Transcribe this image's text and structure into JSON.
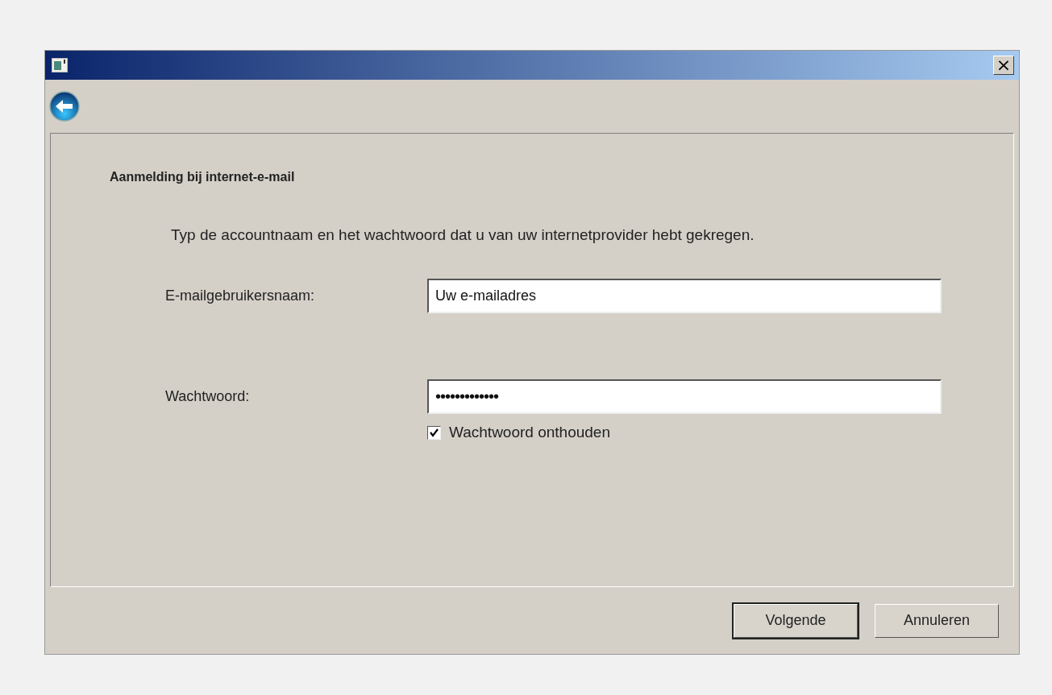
{
  "window": {
    "title_buttons": [
      "×"
    ]
  },
  "heading": "Aanmelding bij internet-e-mail",
  "description": "Typ de accountnaam en het wachtwoord dat u van uw internetprovider hebt gekregen.",
  "fields": [
    {
      "label": "E-mailgebruikersnaam:",
      "value": "Uw e-mailadres"
    },
    {
      "label": "Wachtwoord:",
      "value": "•••••••••••••"
    }
  ],
  "remember": {
    "label": "Wachtwoord onthouden",
    "checked": true
  },
  "buttons": [
    {
      "label": "Volgende",
      "default": true
    },
    {
      "label": "Annuleren",
      "default": false
    }
  ]
}
